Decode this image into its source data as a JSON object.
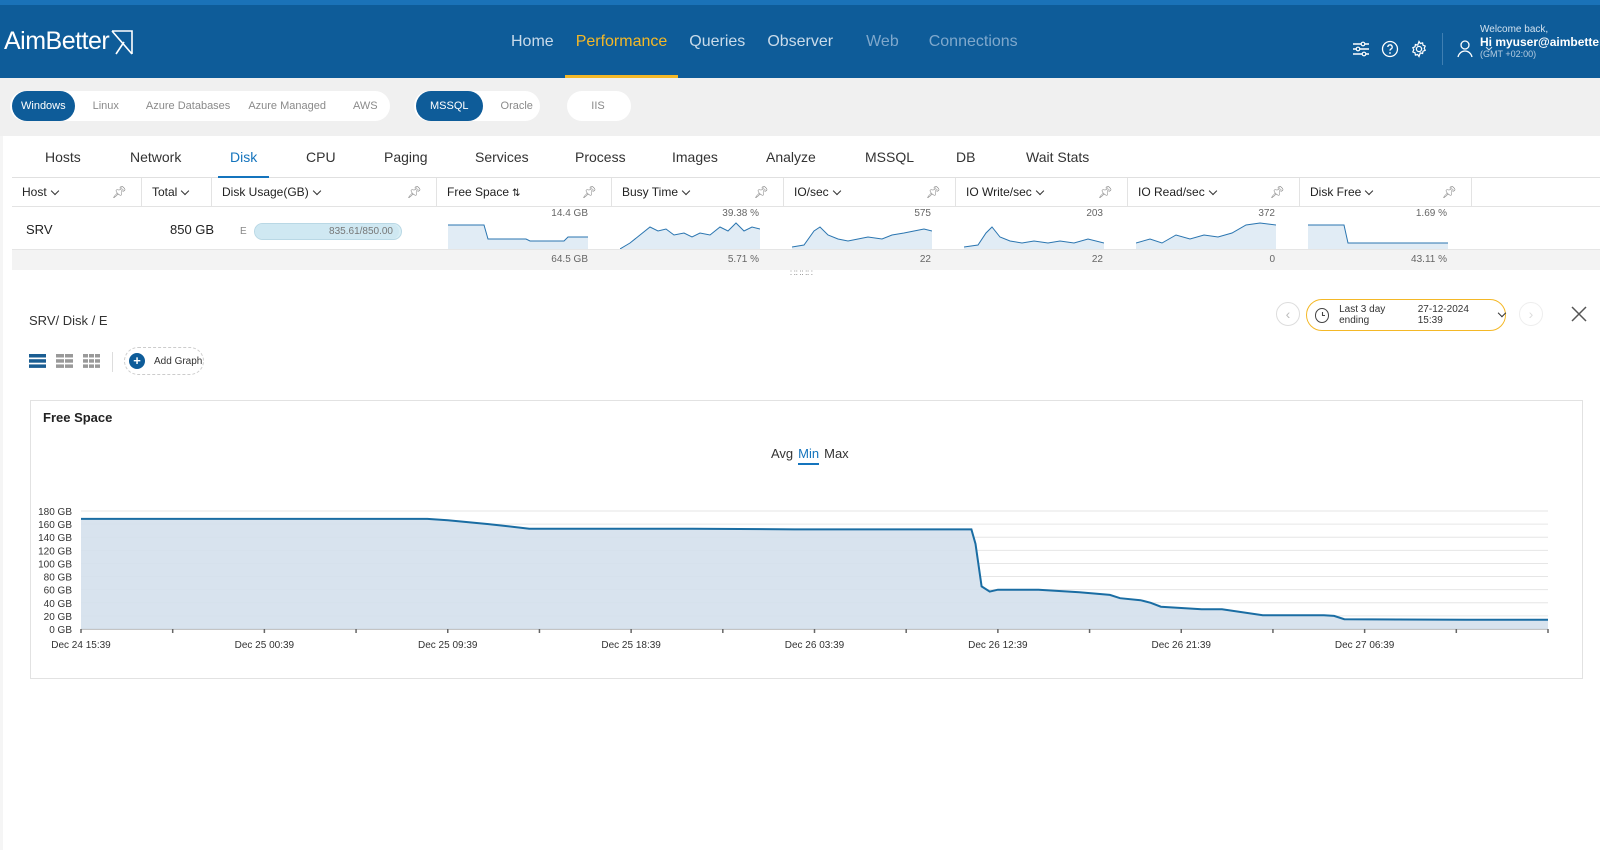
{
  "header": {
    "logo_text": "AimBetter",
    "nav": [
      {
        "label": "Home",
        "state": "normal"
      },
      {
        "label": "Performance",
        "state": "active"
      },
      {
        "label": "Queries",
        "state": "normal"
      },
      {
        "label": "Observer",
        "state": "normal"
      },
      {
        "label": "Web",
        "state": "dim"
      },
      {
        "label": "Connections",
        "state": "dim"
      }
    ],
    "welcome_line1": "Welcome back,",
    "welcome_line2": "Hi myuser@aimbetter....",
    "welcome_line3": "(GMT +02:00)"
  },
  "platforms": {
    "os": [
      "Windows",
      "Linux",
      "Azure Databases",
      "Azure Managed",
      "AWS"
    ],
    "db": [
      "MSSQL",
      "Oracle"
    ],
    "other": [
      "IIS"
    ]
  },
  "subtabs": [
    "Hosts",
    "Network",
    "Disk",
    "CPU",
    "Paging",
    "Services",
    "Process",
    "Images",
    "Analyze",
    "MSSQL",
    "DB",
    "Wait Stats"
  ],
  "table": {
    "columns": [
      "Host",
      "Total",
      "Disk Usage(GB)",
      "Free Space",
      "Busy Time",
      "IO/sec",
      "IO Write/sec",
      "IO Read/sec",
      "Disk Free"
    ],
    "row": {
      "host": "SRV",
      "total": "850 GB",
      "drive": "E",
      "usage": "835.61/850.00",
      "usage_fraction": 0.983,
      "free_space_max": "14.4 GB",
      "free_space_min": "64.5 GB",
      "busy_max": "39.38 %",
      "busy_min": "5.71 %",
      "io_max": "575",
      "io_min": "22",
      "iow_max": "203",
      "iow_min": "22",
      "ior_max": "372",
      "ior_min": "0",
      "diskfree_max": "1.69 %",
      "diskfree_min": "43.11 %"
    }
  },
  "detail": {
    "breadcrumb": "SRV/ Disk / E",
    "time_label": "Last 3 day ending",
    "time_value": "27-12-2024 15:39",
    "add_graph": "Add Graph"
  },
  "chart_data": {
    "type": "area",
    "title": "Free Space",
    "stat_options": [
      "Avg",
      "Min",
      "Max"
    ],
    "stat_selected": "Min",
    "y_ticks": [
      "0 GB",
      "20 GB",
      "40 GB",
      "60 GB",
      "80 GB",
      "100 GB",
      "120 GB",
      "140 GB",
      "160 GB",
      "180 GB"
    ],
    "ylim": [
      0,
      180
    ],
    "x_ticks": [
      "Dec 24 15:39",
      "Dec 25 00:39",
      "Dec 25 09:39",
      "Dec 25 18:39",
      "Dec 26 03:39",
      "Dec 26 12:39",
      "Dec 26 21:39",
      "Dec 27 06:39"
    ],
    "x_range_hours": [
      0,
      72
    ],
    "series": [
      {
        "color": "#1a6da3",
        "fill": "#d4e0ec",
        "points": [
          [
            0,
            168
          ],
          [
            17,
            168
          ],
          [
            18,
            166
          ],
          [
            20,
            160
          ],
          [
            22,
            153
          ],
          [
            30,
            153
          ],
          [
            35,
            152
          ],
          [
            43.7,
            152
          ],
          [
            43.9,
            130
          ],
          [
            44.2,
            65
          ],
          [
            44.6,
            57
          ],
          [
            45,
            60
          ],
          [
            47,
            60
          ],
          [
            49,
            56
          ],
          [
            50.5,
            52
          ],
          [
            51,
            47
          ],
          [
            52,
            44
          ],
          [
            52.5,
            40
          ],
          [
            53,
            34
          ],
          [
            55,
            30
          ],
          [
            56,
            30
          ],
          [
            58,
            21
          ],
          [
            61,
            21
          ],
          [
            61.5,
            20
          ],
          [
            62,
            15
          ],
          [
            68,
            14
          ],
          [
            72,
            14
          ]
        ]
      }
    ]
  },
  "colors": {
    "brand": "#0e5c99",
    "accent": "#f4b827",
    "link": "#1474bd"
  }
}
